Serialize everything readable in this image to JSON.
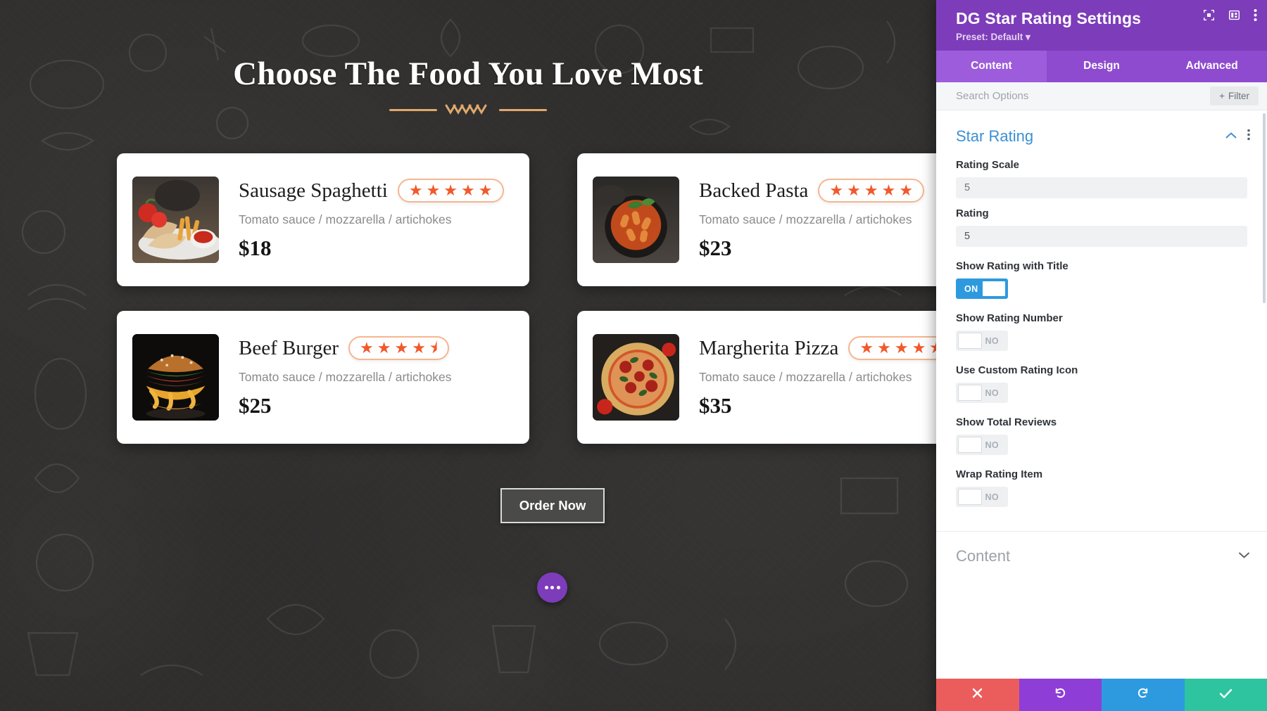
{
  "site": {
    "heading": "Choose The Food You Love Most",
    "divider_color": "#e0a96d",
    "order_button": "Order Now",
    "cards": [
      {
        "title": "Sausage Spaghetti",
        "description": "Tomato sauce / mozzarella / artichokes",
        "price": "$18",
        "rating": 5,
        "rating_scale": 5,
        "image": "sausage-spaghetti-photo"
      },
      {
        "title": "Backed Pasta",
        "description": "Tomato sauce / mozzarella / artichokes",
        "price": "$23",
        "rating": 5,
        "rating_scale": 5,
        "image": "backed-pasta-photo"
      },
      {
        "title": "Beef Burger",
        "description": "Tomato sauce / mozzarella / artichokes",
        "price": "$25",
        "rating": 4.5,
        "rating_scale": 5,
        "image": "beef-burger-photo"
      },
      {
        "title": "Margherita Pizza",
        "description": "Tomato sauce / mozzarella / artichokes",
        "price": "$35",
        "rating": 4.5,
        "rating_scale": 5,
        "image": "margherita-pizza-photo"
      }
    ],
    "star_accent": "#f1592a",
    "pill_border": "#f6b690",
    "fab_icon": "three-dots-icon"
  },
  "modal": {
    "title": "DG Star Rating Settings",
    "preset": "Preset: Default",
    "header_icons": [
      "fullscreen-icon",
      "layout-columns-icon",
      "kebab-menu-icon"
    ],
    "accent": "#7d3cba",
    "tabs": [
      {
        "label": "Content",
        "active": true
      },
      {
        "label": "Design",
        "active": false
      },
      {
        "label": "Advanced",
        "active": false
      }
    ],
    "search": {
      "placeholder": "Search Options",
      "value": "",
      "filter_label": "Filter"
    },
    "section": {
      "title": "Star Rating",
      "collapse_icon": "chevron-up-icon",
      "menu_icon": "kebab-menu-icon"
    },
    "fields": [
      {
        "label": "Rating Scale",
        "value": "5",
        "placeholder": "5",
        "is_placeholder": true
      },
      {
        "label": "Rating",
        "value": "5",
        "placeholder": "5",
        "is_placeholder": false
      }
    ],
    "toggles": [
      {
        "label": "Show Rating with Title",
        "state": "ON",
        "on": true
      },
      {
        "label": "Show Rating Number",
        "state": "NO",
        "on": false
      },
      {
        "label": "Use Custom Rating Icon",
        "state": "NO",
        "on": false
      },
      {
        "label": "Show Total Reviews",
        "state": "NO",
        "on": false
      },
      {
        "label": "Wrap Rating Item",
        "state": "NO",
        "on": false
      }
    ],
    "collapsed_section": {
      "title": "Content",
      "icon": "chevron-down-icon"
    },
    "footer": [
      {
        "name": "cancel",
        "icon": "close-x-icon",
        "color": "#eb5c5c"
      },
      {
        "name": "undo",
        "icon": "undo-arrow-icon",
        "color": "#8e3ed6"
      },
      {
        "name": "redo",
        "icon": "redo-arrow-icon",
        "color": "#2d9ae0"
      },
      {
        "name": "save",
        "icon": "check-icon",
        "color": "#2ec4a0"
      }
    ]
  }
}
